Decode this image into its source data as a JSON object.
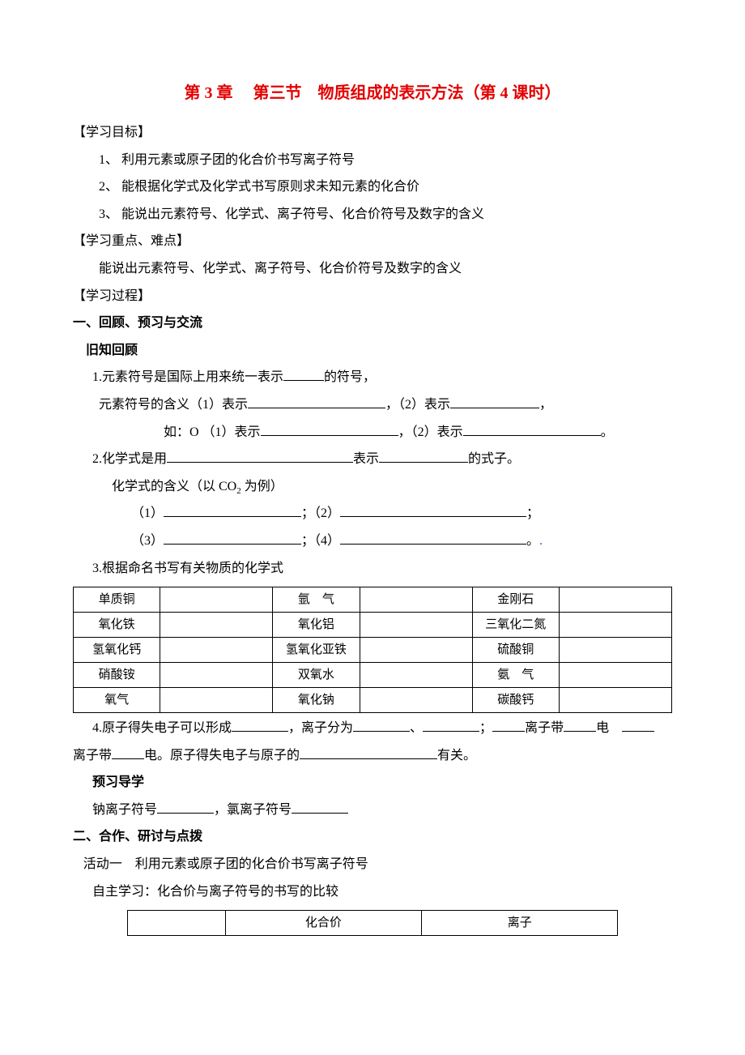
{
  "title": "第 3 章　 第三节　物质组成的表示方法（第 4 课时）",
  "sections": {
    "s1_heading": "【学习目标】",
    "s1_item1": "1、 利用元素或原子团的化合价书写离子符号",
    "s1_item2": "2、 能根据化学式及化学式书写原则求未知元素的化合价",
    "s1_item3": "3、 能说出元素符号、化学式、离子符号、化合价符号及数字的含义",
    "s2_heading": "【学习重点、难点】",
    "s2_line": "能说出元素符号、化学式、离子符号、化合价符号及数字的含义",
    "s3_heading": "【学习过程】",
    "s3_sub1": "一、回顾、预习与交流",
    "s3_oldknow": "旧知回顾",
    "q1_line1a": "1.元素符号是国际上用来统一表示",
    "q1_line1b": "的符号，",
    "q1_line2a": "元素符号的含义（1）表示",
    "q1_line2b": "，（2）表示",
    "q1_line2c": "，",
    "q1_line3a": "如：O （1）表示",
    "q1_line3b": "，（2）表示",
    "q1_line3c": "。",
    "q2_line1a": "2.化学式是用",
    "q2_line1b": "表示",
    "q2_line1c": "的式子。",
    "q2_line2": "化学式的含义（以 CO",
    "q2_line2b": " 为例）",
    "q2_line3a": "（1）",
    "q2_line3_mid": "；（2）",
    "q2_line3_end": "；",
    "q2_line4a": "（3）",
    "q2_line4_mid": "；（4）",
    "q2_line4_end": "。",
    "q3_heading": "3.根据命名书写有关物质的化学式",
    "q4_line1a": "4.原子得失电子可以形成",
    "q4_line1b": "，离子分为",
    "q4_line1c": "、",
    "q4_line1d": "；",
    "q4_line1e": "离子带",
    "q4_line1f": "电",
    "q4_line2a": "离子带",
    "q4_line2b": "电。原子得失电子与原子的",
    "q4_line2c": "有关。",
    "preview_heading": "预习导学",
    "preview_line1a": "钠离子符号",
    "preview_line1b": "，氯离子符号",
    "s3_sub2": "二、合作、研讨与点拨",
    "activity1": "活动一　利用元素或原子团的化合价书写离子符号",
    "activity1_sub": "自主学习：化合价与离子符号的书写的比较"
  },
  "table1": {
    "rows": [
      [
        "单质铜",
        "",
        "氩　气",
        "",
        "金刚石",
        ""
      ],
      [
        "氧化铁",
        "",
        "氧化铝",
        "",
        "三氧化二氮",
        ""
      ],
      [
        "氢氧化钙",
        "",
        "氢氧化亚铁",
        "",
        "硫酸铜",
        ""
      ],
      [
        "硝酸铵",
        "",
        "双氧水",
        "",
        "氨　气",
        ""
      ],
      [
        "氧气",
        "",
        "氧化钠",
        "",
        "碳酸钙",
        ""
      ]
    ]
  },
  "table2": {
    "header": [
      "",
      "化合价",
      "离子"
    ]
  }
}
